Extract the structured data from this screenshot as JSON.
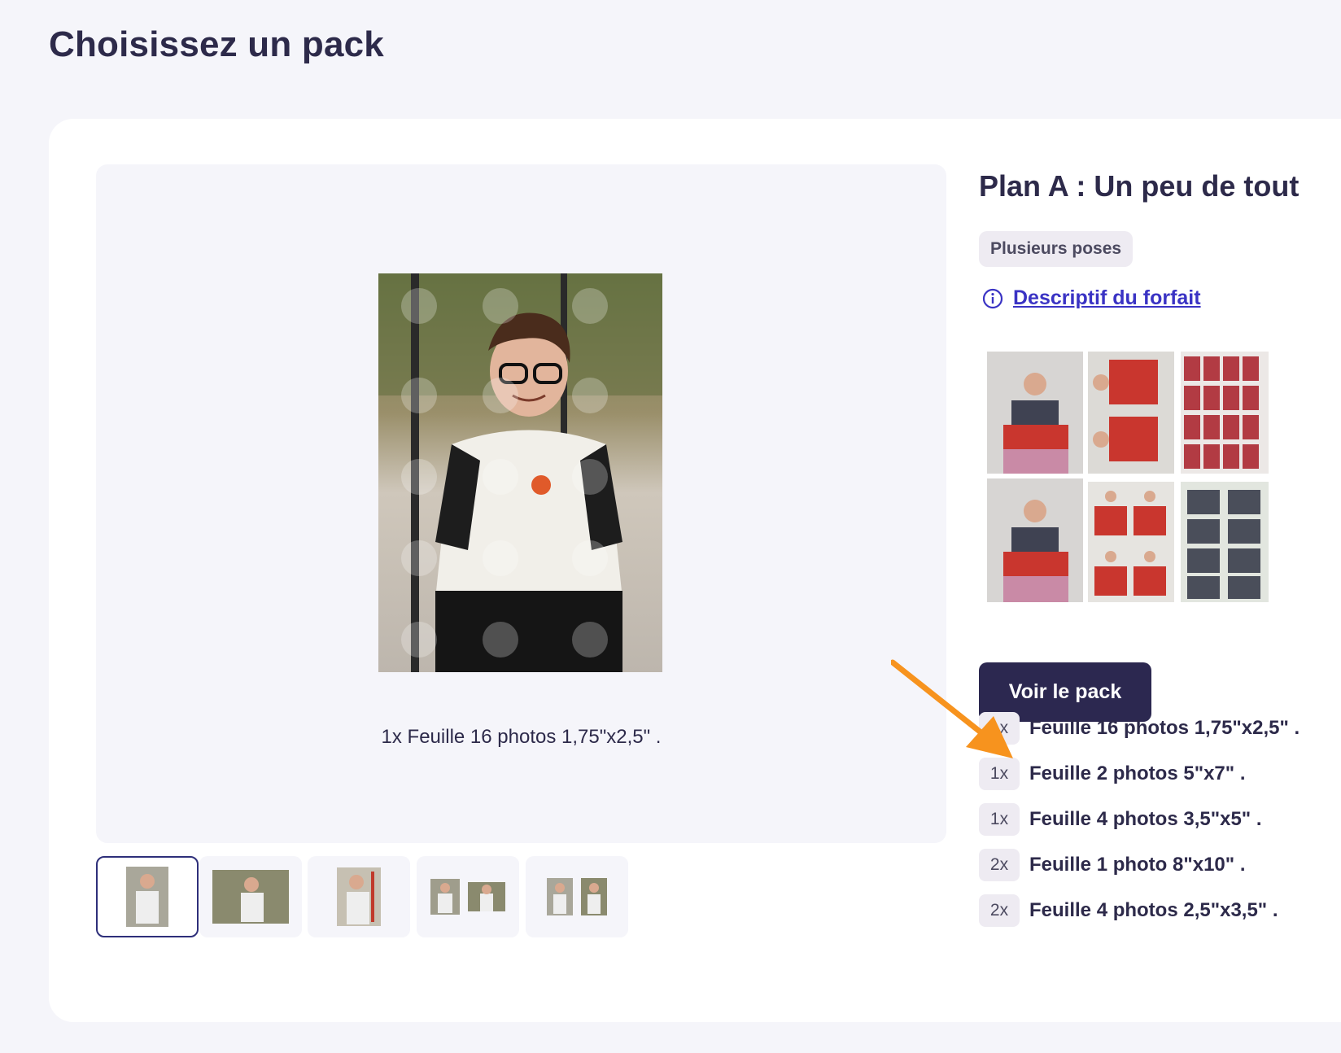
{
  "page": {
    "title": "Choisissez un pack"
  },
  "preview": {
    "caption": "1x Feuille 16 photos 1,75\"x2,5\" .",
    "thumbnails": [
      {
        "name": "thumb-1",
        "active": true
      },
      {
        "name": "thumb-2",
        "active": false
      },
      {
        "name": "thumb-3",
        "active": false
      },
      {
        "name": "thumb-4",
        "active": false
      },
      {
        "name": "thumb-5",
        "active": false
      }
    ]
  },
  "plan": {
    "title": "Plan A : Un peu de tout",
    "badge": "Plusieurs poses",
    "description_link": "Descriptif du forfait",
    "description_icon": "info-circle-icon",
    "button_label": "Voir le pack",
    "items": [
      {
        "qty": "1x",
        "label": "Feuille 16 photos 1,75\"x2,5\" ."
      },
      {
        "qty": "1x",
        "label": "Feuille 2 photos 5\"x7\" ."
      },
      {
        "qty": "1x",
        "label": "Feuille 4 photos 3,5\"x5\" ."
      },
      {
        "qty": "2x",
        "label": "Feuille 1 photo 8\"x10\" ."
      },
      {
        "qty": "2x",
        "label": "Feuille 4 photos 2,5\"x3,5\" ."
      }
    ]
  },
  "colors": {
    "background": "#f5f5fa",
    "card": "#ffffff",
    "primary": "#2c2850",
    "link": "#3a33c4",
    "badge_bg": "#eeebf2",
    "annotation_arrow": "#f7931e"
  }
}
